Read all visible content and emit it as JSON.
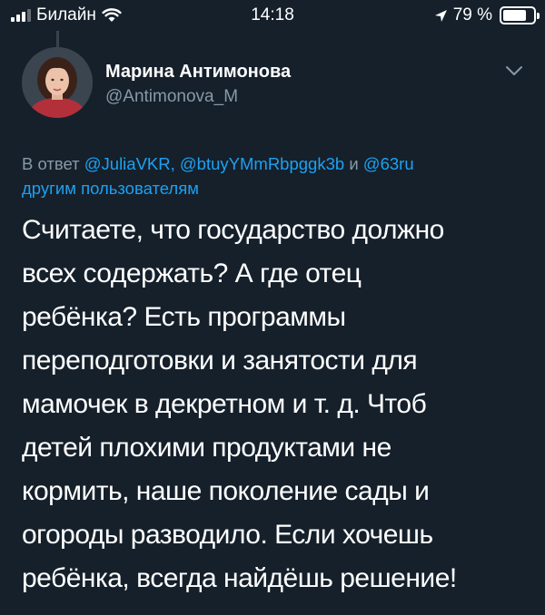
{
  "status_bar": {
    "carrier": "Билайн",
    "time": "14:18",
    "battery_percent": "79 %",
    "battery_level": 0.79,
    "icons": [
      "signal-icon",
      "wifi-icon",
      "location-arrow-icon",
      "battery-icon"
    ]
  },
  "tweet": {
    "author": {
      "name": "Марина Антимонова",
      "handle": "@Antimonova_M"
    },
    "reply_context": {
      "prefix": "В ответ",
      "mentions": [
        "@JuliaVKR,",
        "@btuyYMmRbpggk3b",
        "@63ru"
      ],
      "conjunction": "и",
      "suffix": "другим пользователям"
    },
    "text_lines": [
      "Считаете, что государство должно",
      "всех содержать?  А где отец",
      "ребёнка? Есть программы",
      "переподготовки и занятости для",
      "мамочек в декретном и т. д. Чтоб",
      "детей плохими продуктами не",
      "кормить, наше поколение сады и",
      "огороды разводило. Если хочешь",
      "ребёнка, всегда найдёшь решение!"
    ]
  },
  "colors": {
    "background": "#15202b",
    "text_primary": "#ffffff",
    "text_secondary": "#8899a6",
    "link": "#1da1f2",
    "thread_line": "#38444d"
  }
}
